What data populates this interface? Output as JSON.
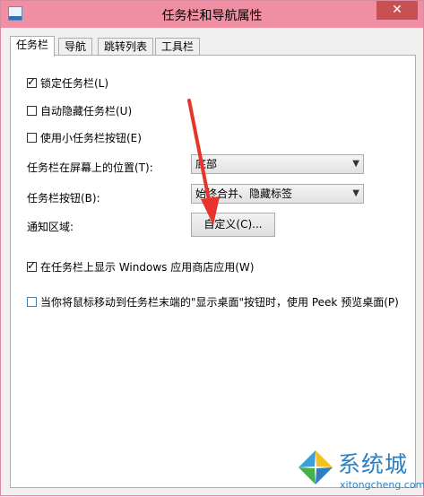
{
  "window": {
    "title": "任务栏和导航属性",
    "close_label": "✕"
  },
  "tabs": [
    {
      "label": "任务栏",
      "active": true
    },
    {
      "label": "导航",
      "active": false
    },
    {
      "label": "跳转列表",
      "active": false
    },
    {
      "label": "工具栏",
      "active": false
    }
  ],
  "options": {
    "lock_taskbar": {
      "label": "锁定任务栏(L)",
      "checked": true
    },
    "auto_hide": {
      "label": "自动隐藏任务栏(U)",
      "checked": false
    },
    "small_buttons": {
      "label": "使用小任务栏按钮(E)",
      "checked": false
    },
    "store_apps": {
      "label": "在任务栏上显示 Windows 应用商店应用(W)",
      "checked": true
    },
    "peek": {
      "label": "当你将鼠标移动到任务栏末端的\"显示桌面\"按钮时，使用 Peek 预览桌面(P)",
      "checked": false
    }
  },
  "position": {
    "label": "任务栏在屏幕上的位置(T):",
    "value": "底部"
  },
  "buttons_setting": {
    "label": "任务栏按钮(B):",
    "value": "始终合并、隐藏标签"
  },
  "notification": {
    "label": "通知区域:",
    "button_label": "自定义(C)..."
  },
  "check_glyph": "✓",
  "dropdown_glyph": "▼",
  "watermark": {
    "brand": "系统城",
    "domain": "xitongcheng.com"
  },
  "colors": {
    "titlebar": "#f08fa4",
    "close": "#c75050",
    "annotation_arrow": "#e8322b",
    "watermark": "#2b7fc2"
  }
}
